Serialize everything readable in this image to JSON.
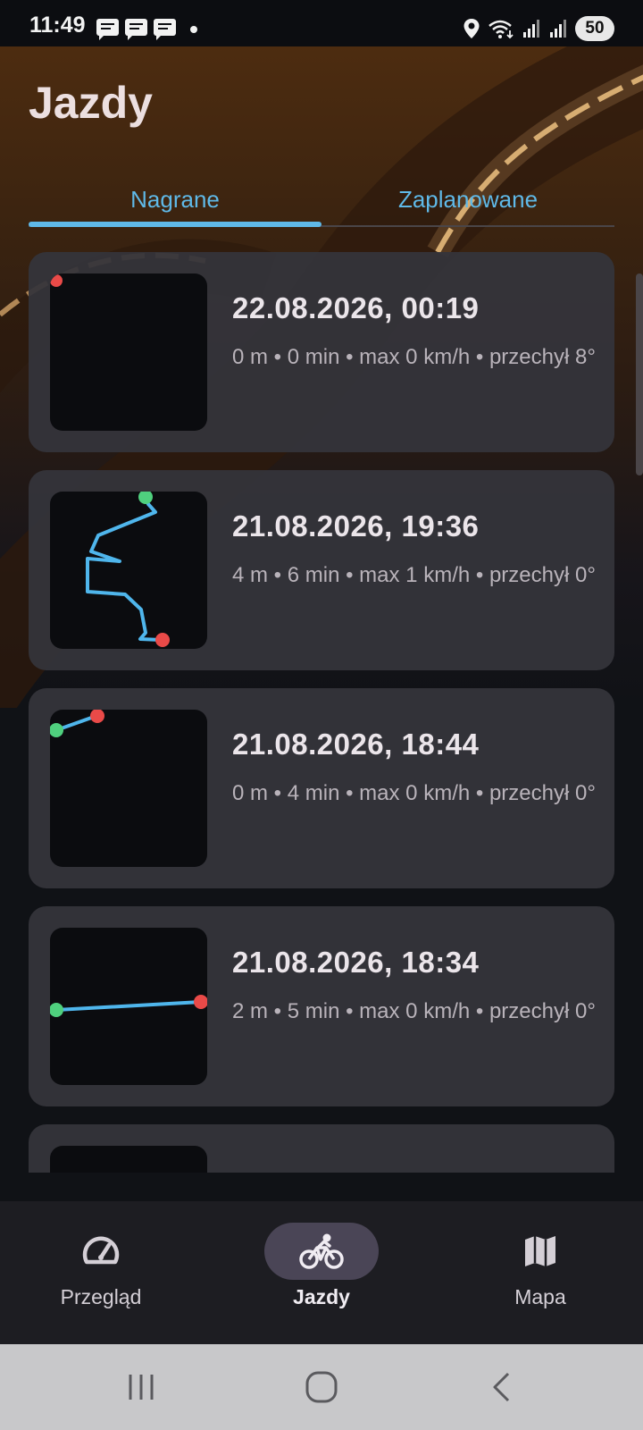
{
  "status_bar": {
    "time": "11:49",
    "battery": "50"
  },
  "header": {
    "title": "Jazdy"
  },
  "tabs": [
    {
      "label": "Nagrane",
      "active": true
    },
    {
      "label": "Zaplanowane",
      "active": false
    }
  ],
  "rides": [
    {
      "title": "22.08.2026, 00:19",
      "stats": "0 m • 0 min • max 0 km/h • przechył 8°"
    },
    {
      "title": "21.08.2026, 19:36",
      "stats": "4 m • 6 min • max 1 km/h • przechył 0°"
    },
    {
      "title": "21.08.2026, 18:44",
      "stats": "0 m • 4 min • max 0 km/h • przechył 0°"
    },
    {
      "title": "21.08.2026, 18:34",
      "stats": "2 m • 5 min • max 0 km/h • przechył 0°"
    }
  ],
  "bottom_nav": {
    "items": [
      {
        "label": "Przegląd",
        "icon": "speedometer-icon",
        "active": false
      },
      {
        "label": "Jazdy",
        "icon": "bicycle-icon",
        "active": true
      },
      {
        "label": "Mapa",
        "icon": "map-icon",
        "active": false
      }
    ]
  },
  "colors": {
    "accent": "#5fb9e8",
    "route": "#4fb6ec",
    "start_marker": "#4fd07e",
    "end_marker": "#e94a48"
  }
}
